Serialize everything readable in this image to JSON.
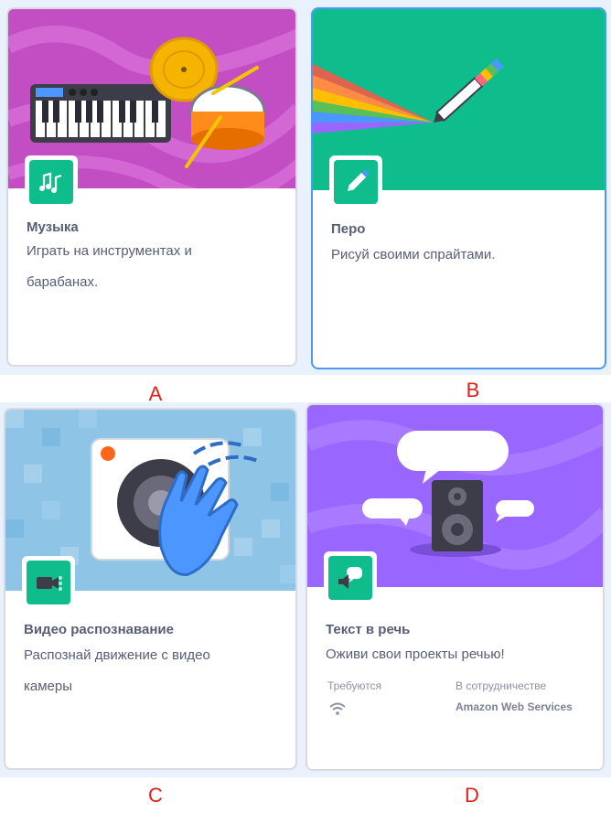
{
  "cards": {
    "music": {
      "title": "Музыка",
      "description": "Играть на инструментах и барабанах.",
      "icon": "music-notes-icon",
      "letter": "A"
    },
    "pen": {
      "title": "Перо",
      "description": "Рисуй своими спрайтами.",
      "icon": "pen-icon",
      "letter": "B"
    },
    "video": {
      "title": "Видео распознавание",
      "description": "Распознай движение с видео камеры",
      "icon": "video-camera-icon",
      "letter": "C"
    },
    "tts": {
      "title": "Текст в речь",
      "description": "Оживи свои проекты речью!",
      "icon": "speech-bubble-speaker-icon",
      "requires_label": "Требуются",
      "requires_icon": "wifi-icon",
      "collab_label": "В сотрудничестве",
      "collab_value": "Amazon Web Services",
      "letter": "D"
    }
  },
  "colors": {
    "accent_green": "#0fbd8c",
    "selected_border": "#4c97ff",
    "label_red": "#e0201e",
    "text": "#575e75"
  }
}
